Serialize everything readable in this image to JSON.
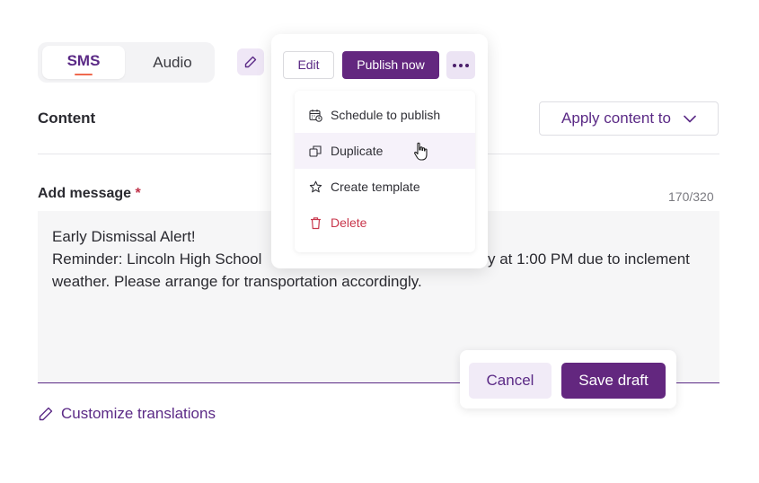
{
  "tabs": {
    "sms": "SMS",
    "audio": "Audio"
  },
  "content": {
    "title": "Content",
    "apply_label": "Apply content to"
  },
  "message": {
    "label": "Add message",
    "required_mark": "*",
    "counter": "170/320",
    "lines": [
      "Early Dismissal Alert!",
      "Reminder: Lincoln High School",
      "y at 1:00 PM due to inclement",
      "weather. Please arrange for transportation accordingly."
    ]
  },
  "customize_label": "Customize translations",
  "actions": {
    "cancel": "Cancel",
    "save_draft": "Save draft"
  },
  "popover": {
    "edit": "Edit",
    "publish": "Publish now",
    "menu": [
      {
        "label": "Schedule to publish",
        "icon": "calendar-clock-icon"
      },
      {
        "label": "Duplicate",
        "icon": "duplicate-icon"
      },
      {
        "label": "Create template",
        "icon": "star-icon"
      },
      {
        "label": "Delete",
        "icon": "trash-icon"
      }
    ]
  },
  "colors": {
    "brand": "#63277f",
    "brand_text": "#5b2a86",
    "accent_underline": "#ef6a4f",
    "danger": "#c8364b"
  }
}
